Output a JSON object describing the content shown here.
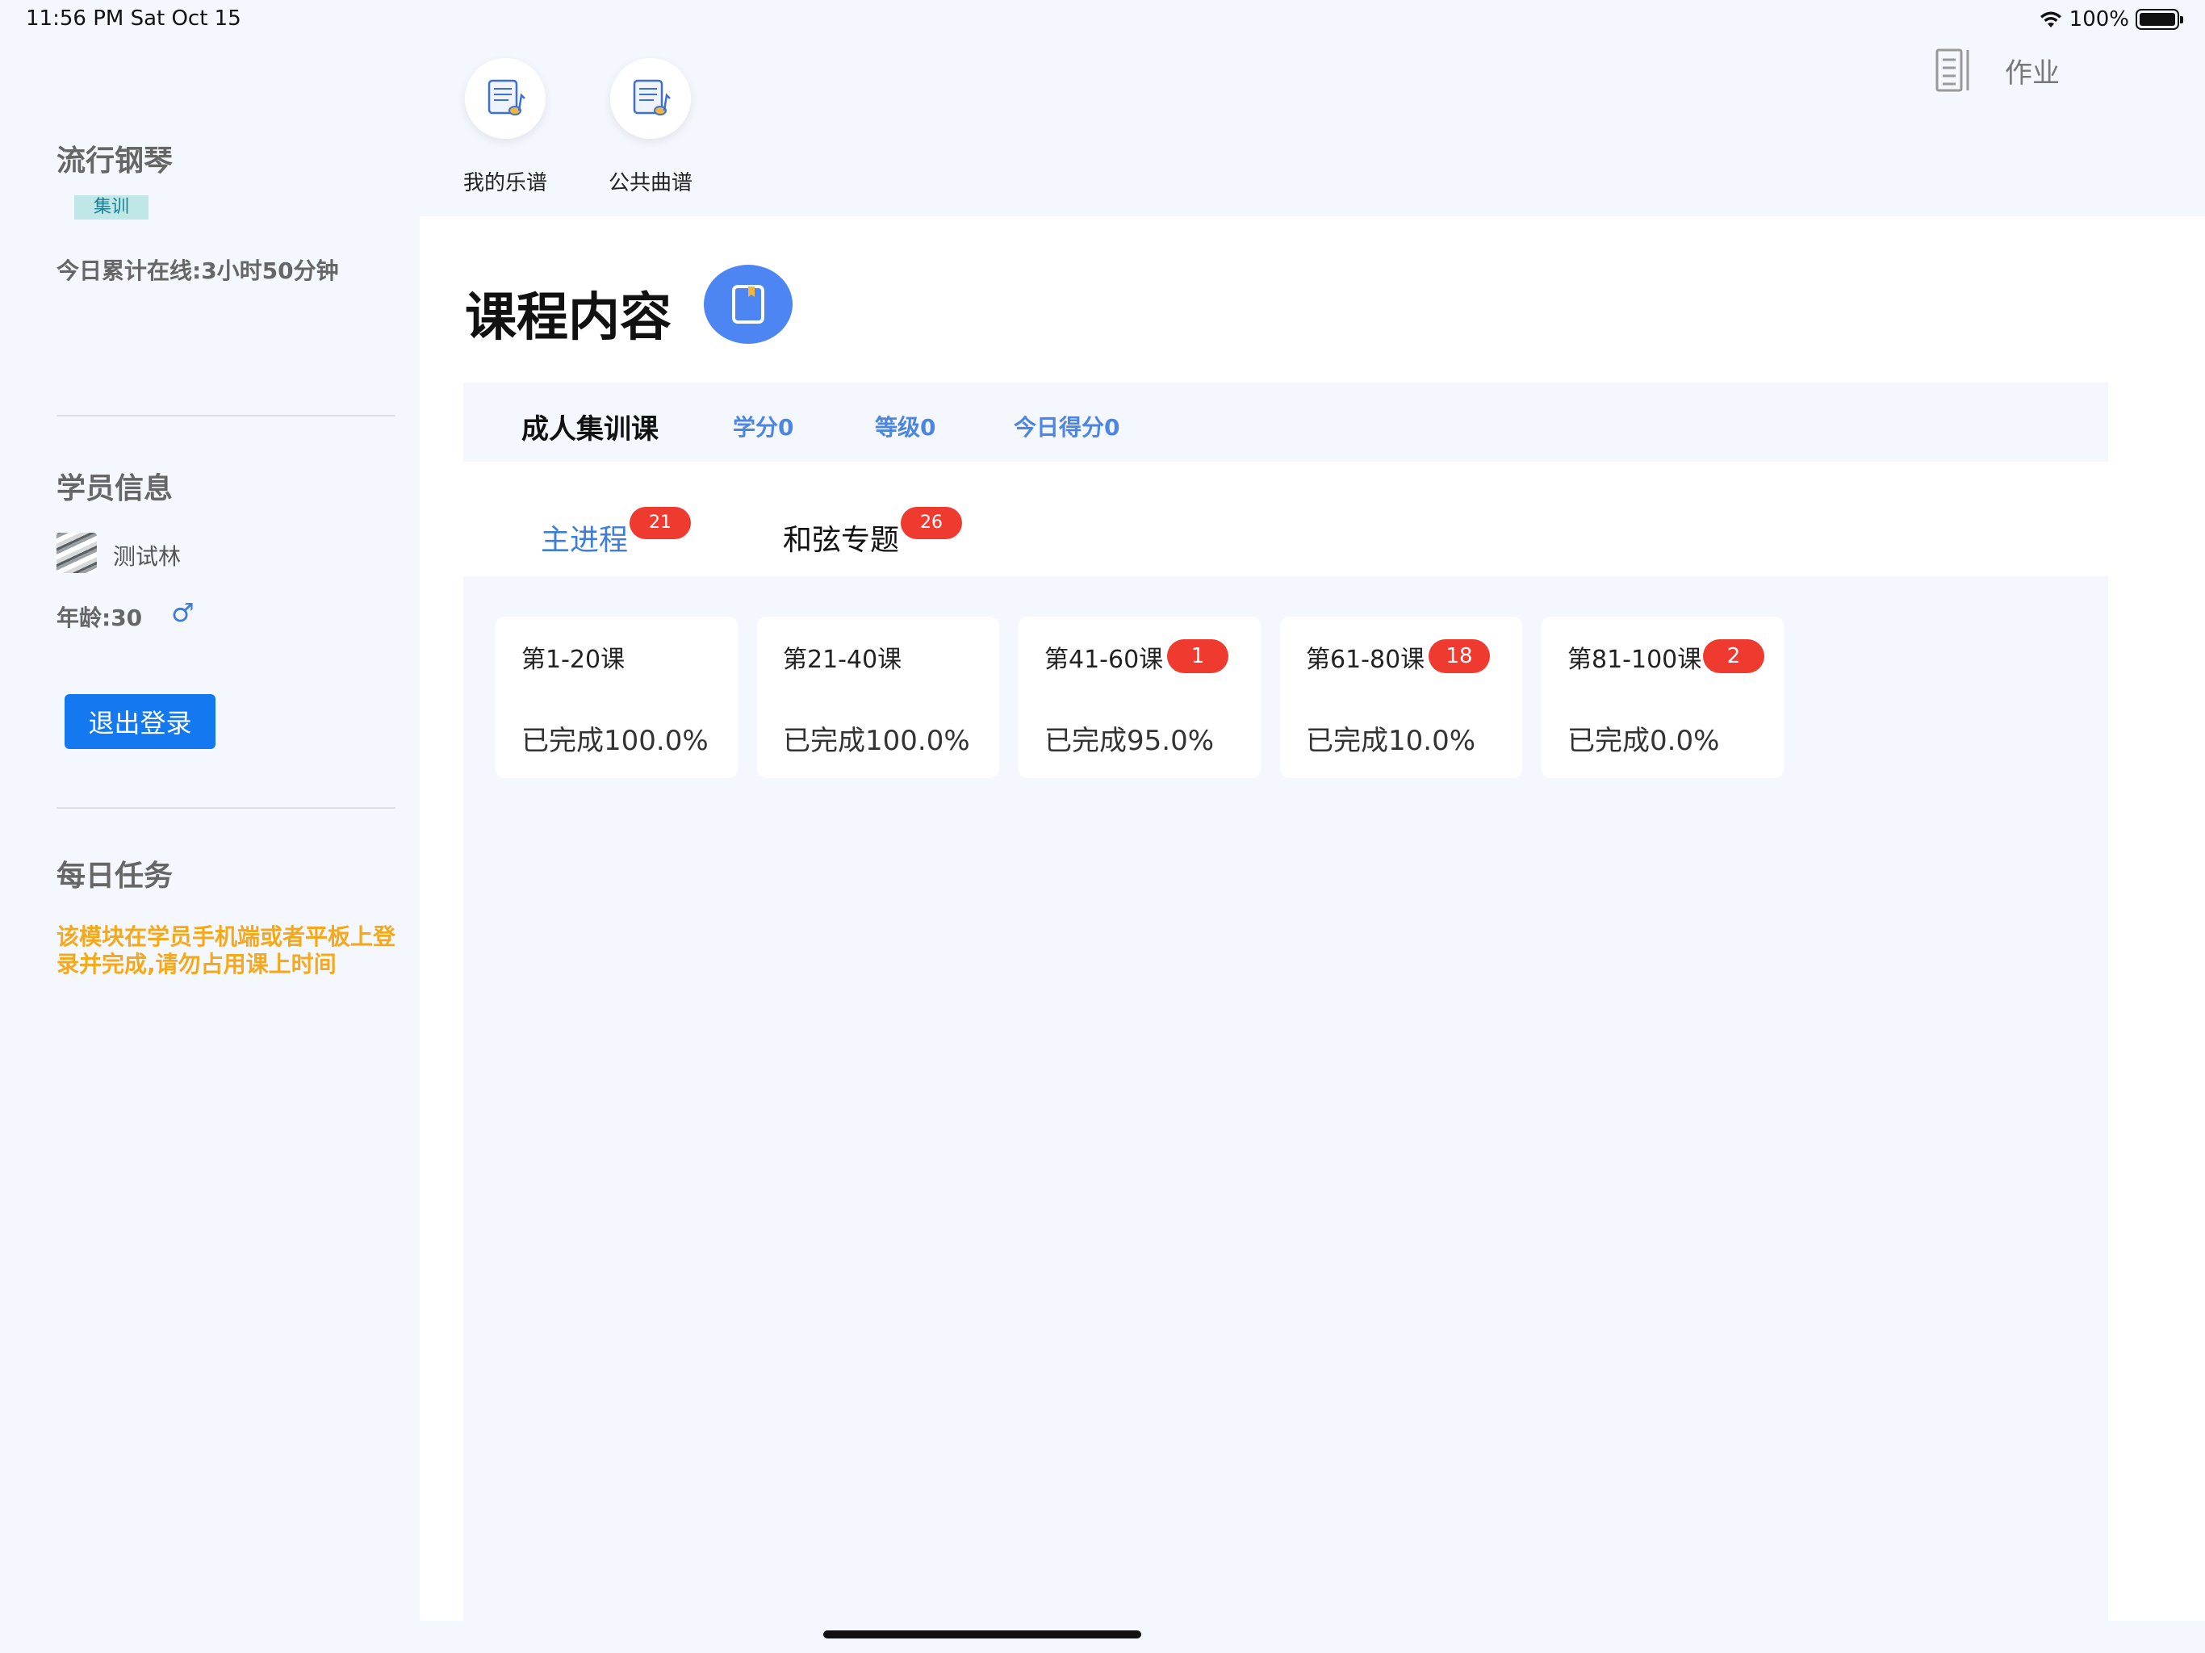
{
  "status_bar": {
    "time": "11:56 PM  Sat Oct 15",
    "battery": "100%"
  },
  "sidebar": {
    "app_title": "流行钢琴",
    "badge": "集训",
    "online_today": "今日累计在线:3小时50分钟",
    "student_section_title": "学员信息",
    "student_name": "测试林",
    "student_age": "年龄:30",
    "gender_symbol": "♂",
    "logout_label": "退出登录",
    "daily_task_title": "每日任务",
    "daily_task_note": "该模块在学员手机端或者平板上登录并完成,请勿占用课上时间"
  },
  "shortcuts": [
    {
      "label": "我的乐谱",
      "icon": "music-score-icon"
    },
    {
      "label": "公共曲谱",
      "icon": "music-score-icon"
    }
  ],
  "header": {
    "homework_label": "作业"
  },
  "main": {
    "title": "课程内容",
    "course": {
      "name": "成人集训课",
      "credits": "学分0",
      "level": "等级0",
      "today_score": "今日得分0"
    },
    "tabs": [
      {
        "label": "主进程",
        "badge": "21",
        "active": true
      },
      {
        "label": "和弦专题",
        "badge": "26",
        "active": false
      }
    ],
    "lessons": [
      {
        "range": "第1-20课",
        "badge": "",
        "progress": "已完成100.0%"
      },
      {
        "range": "第21-40课",
        "badge": "",
        "progress": "已完成100.0%"
      },
      {
        "range": "第41-60课",
        "badge": "1",
        "progress": "已完成95.0%"
      },
      {
        "range": "第61-80课",
        "badge": "18",
        "progress": "已完成10.0%"
      },
      {
        "range": "第81-100课",
        "badge": "2",
        "progress": "已完成0.0%"
      }
    ]
  },
  "colors": {
    "accent_blue": "#4d86f3",
    "badge_red": "#ee3a2f",
    "warning_orange": "#f4a81c",
    "logout_blue": "#1478f0"
  }
}
